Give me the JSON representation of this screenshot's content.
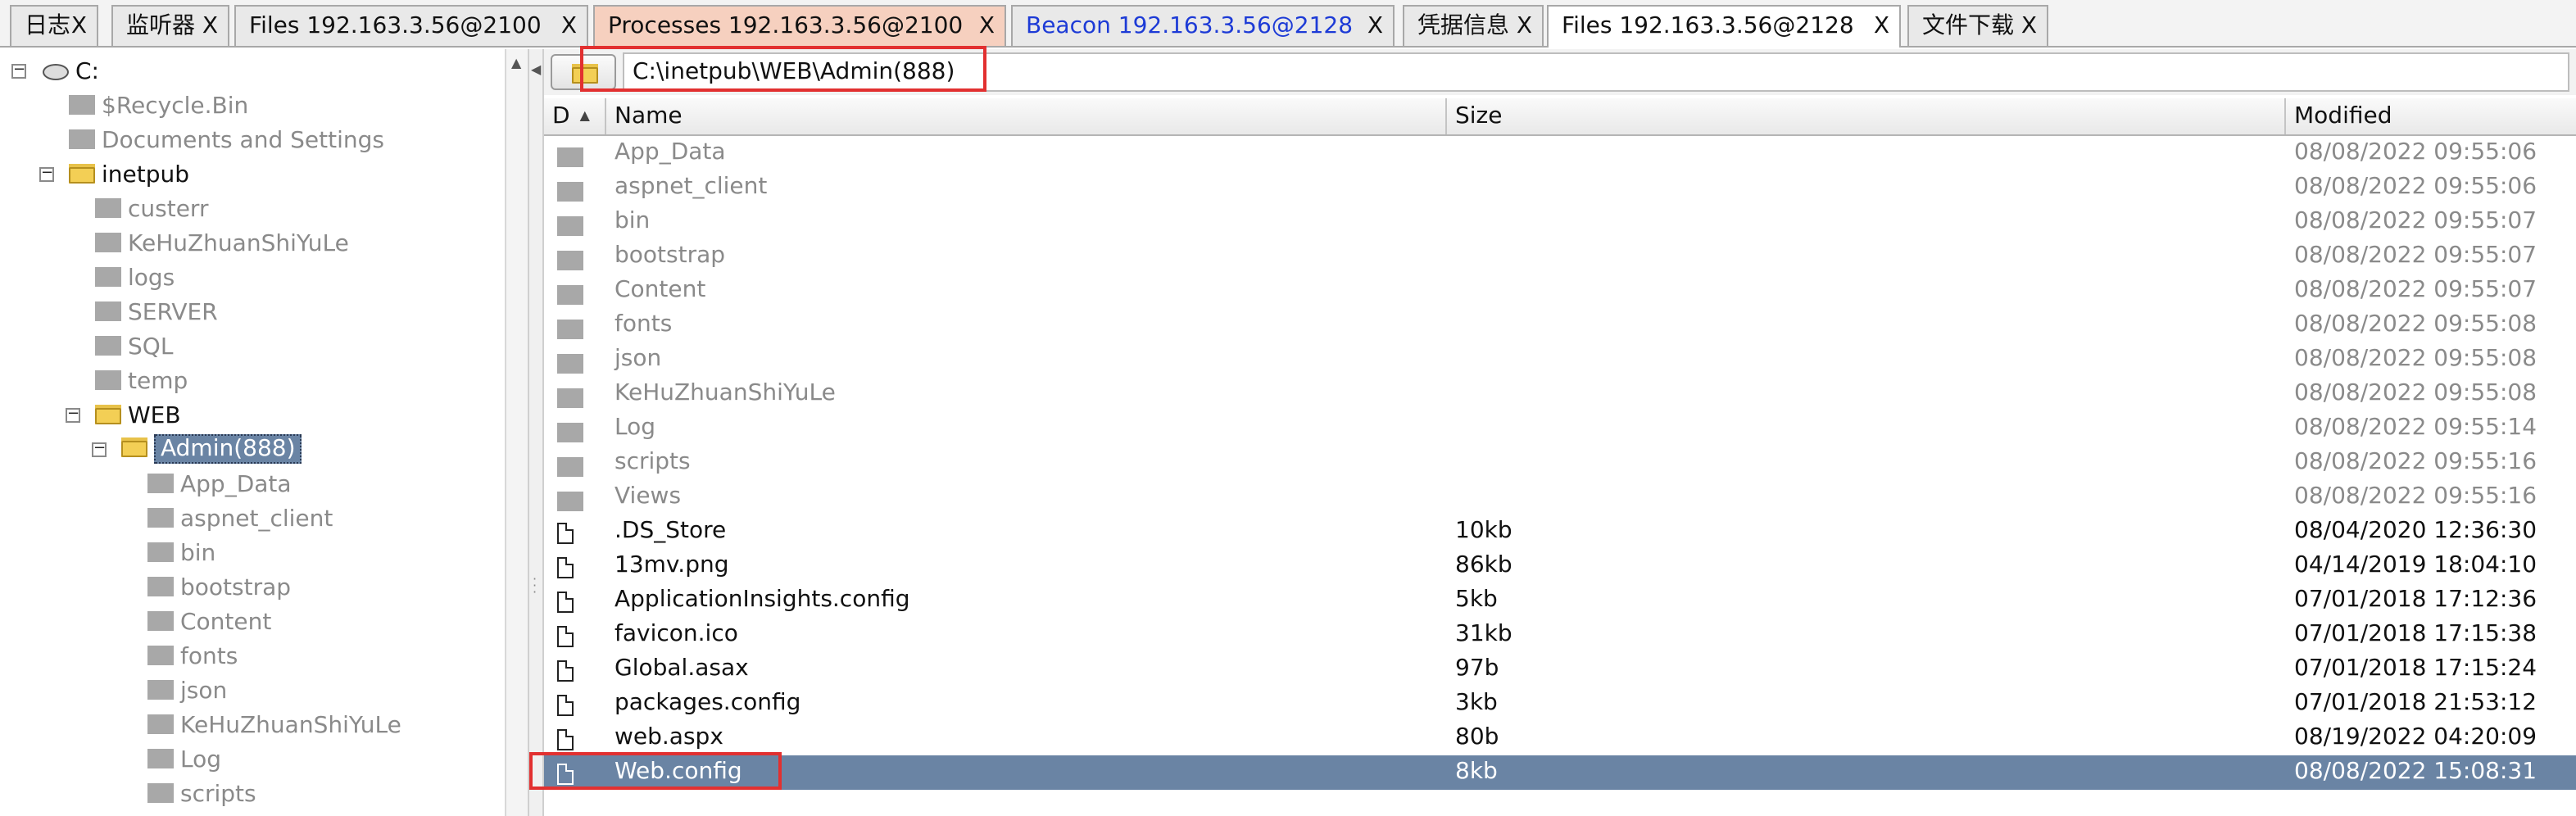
{
  "tabs": [
    {
      "label": "日志",
      "close": "X"
    },
    {
      "label": "监听器",
      "close": "X"
    },
    {
      "label": "Files 192.163.3.56@2100",
      "close": "X"
    },
    {
      "label": "Processes 192.163.3.56@2100",
      "close": "X"
    },
    {
      "label": "Beacon 192.163.3.56@2128",
      "close": "X"
    },
    {
      "label": "凭据信息",
      "close": "X"
    },
    {
      "label": "Files 192.163.3.56@2128",
      "close": "X"
    },
    {
      "label": "文件下载",
      "close": "X"
    }
  ],
  "tree": {
    "nodes": [
      {
        "label": "C:",
        "icon": "drive-icon"
      },
      {
        "label": "$Recycle.Bin"
      },
      {
        "label": "Documents and Settings"
      },
      {
        "label": "inetpub"
      },
      {
        "label": "custerr"
      },
      {
        "label": "KeHuZhuanShiYuLe"
      },
      {
        "label": "logs"
      },
      {
        "label": "SERVER"
      },
      {
        "label": "SQL"
      },
      {
        "label": "temp"
      },
      {
        "label": "WEB"
      },
      {
        "label": "Admin(888)"
      },
      {
        "label": "App_Data"
      },
      {
        "label": "aspnet_client"
      },
      {
        "label": "bin"
      },
      {
        "label": "bootstrap"
      },
      {
        "label": "Content"
      },
      {
        "label": "fonts"
      },
      {
        "label": "json"
      },
      {
        "label": "KeHuZhuanShiYuLe"
      },
      {
        "label": "Log"
      },
      {
        "label": "scripts"
      }
    ]
  },
  "pathbar": {
    "path": "C:\\inetpub\\WEB\\Admin(888)"
  },
  "table": {
    "columns": [
      "D",
      "Name",
      "Size",
      "Modified"
    ],
    "rows": [
      {
        "name": "App_Data",
        "size": "",
        "modified": "08/08/2022 09:55:06"
      },
      {
        "name": "aspnet_client",
        "size": "",
        "modified": "08/08/2022 09:55:06"
      },
      {
        "name": "bin",
        "size": "",
        "modified": "08/08/2022 09:55:07"
      },
      {
        "name": "bootstrap",
        "size": "",
        "modified": "08/08/2022 09:55:07"
      },
      {
        "name": "Content",
        "size": "",
        "modified": "08/08/2022 09:55:07"
      },
      {
        "name": "fonts",
        "size": "",
        "modified": "08/08/2022 09:55:08"
      },
      {
        "name": "json",
        "size": "",
        "modified": "08/08/2022 09:55:08"
      },
      {
        "name": "KeHuZhuanShiYuLe",
        "size": "",
        "modified": "08/08/2022 09:55:08"
      },
      {
        "name": "Log",
        "size": "",
        "modified": "08/08/2022 09:55:14"
      },
      {
        "name": "scripts",
        "size": "",
        "modified": "08/08/2022 09:55:16"
      },
      {
        "name": "Views",
        "size": "",
        "modified": "08/08/2022 09:55:16"
      },
      {
        "name": ".DS_Store",
        "size": "10kb",
        "modified": "08/04/2020 12:36:30"
      },
      {
        "name": "13mv.png",
        "size": "86kb",
        "modified": "04/14/2019 18:04:10"
      },
      {
        "name": "ApplicationInsights.config",
        "size": "5kb",
        "modified": "07/01/2018 17:12:36"
      },
      {
        "name": "favicon.ico",
        "size": "31kb",
        "modified": "07/01/2018 17:15:38"
      },
      {
        "name": "Global.asax",
        "size": "97b",
        "modified": "07/01/2018 17:15:24"
      },
      {
        "name": "packages.config",
        "size": "3kb",
        "modified": "07/01/2018 21:53:12"
      },
      {
        "name": "web.aspx",
        "size": "80b",
        "modified": "08/19/2022 04:20:09"
      },
      {
        "name": "Web.config",
        "size": "8kb",
        "modified": "08/08/2022 15:08:31"
      }
    ]
  },
  "colors": {
    "selection": "#6a84a4",
    "highlight_box": "#e23030",
    "processes_tab": "#f6d0bf",
    "beacon_tab_text": "#1d3bd6"
  }
}
